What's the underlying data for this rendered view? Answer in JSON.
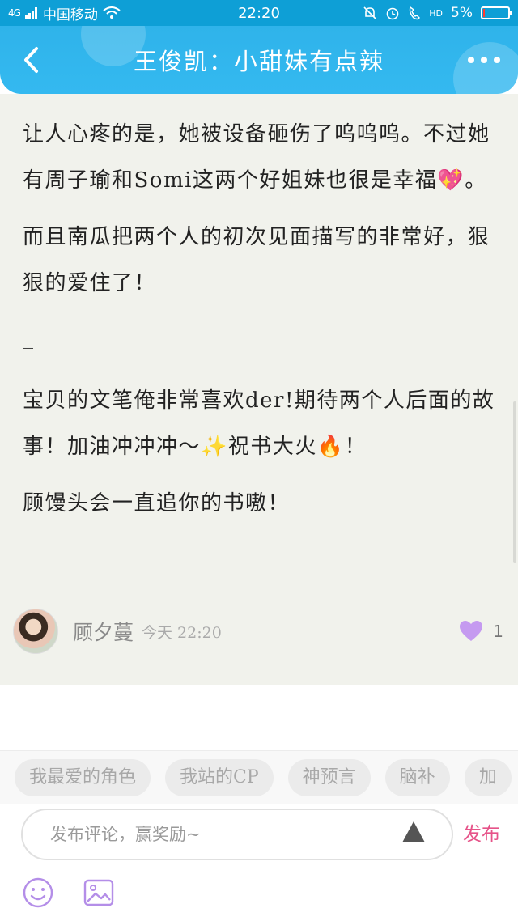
{
  "status_bar": {
    "signal_label": "4G",
    "carrier": "中国移动",
    "time": "22:20",
    "hd_label": "HD",
    "battery": "5%",
    "battery_level": 0.05,
    "battery_color": "#ff3b30"
  },
  "header": {
    "title": "王俊凯：小甜妹有点辣",
    "accent_color": "#2fb3ea"
  },
  "comment": {
    "paragraphs": [
      "让人心疼的是，她被设备砸伤了呜呜呜。不过她有周子瑜和Somi这两个好姐妹也很是幸福💖。",
      "而且南瓜把两个人的初次见面描写的非常好，狠狠的爱住了！",
      "_",
      "宝贝的文笔俺非常喜欢der!期待两个人后面的故事！加油冲冲冲～✨祝书大火🔥！",
      "顾馒头会一直追你的书嗷！"
    ],
    "author": "顾夕蔓",
    "time": "今天 22:20",
    "likes": "1",
    "like_color": "#c59af0"
  },
  "tags": [
    "我最爱的角色",
    "我站的CP",
    "神预言",
    "脑补",
    "加"
  ],
  "input": {
    "placeholder": "发布评论，赢奖励~",
    "publish_label": "发布",
    "publish_color": "#e65389"
  },
  "icons": {
    "back": "chevron-left-icon",
    "more": "more-dots-icon",
    "like": "heart-icon",
    "send": "triangle-up-icon",
    "emoji": "smiley-icon",
    "image": "image-icon"
  }
}
